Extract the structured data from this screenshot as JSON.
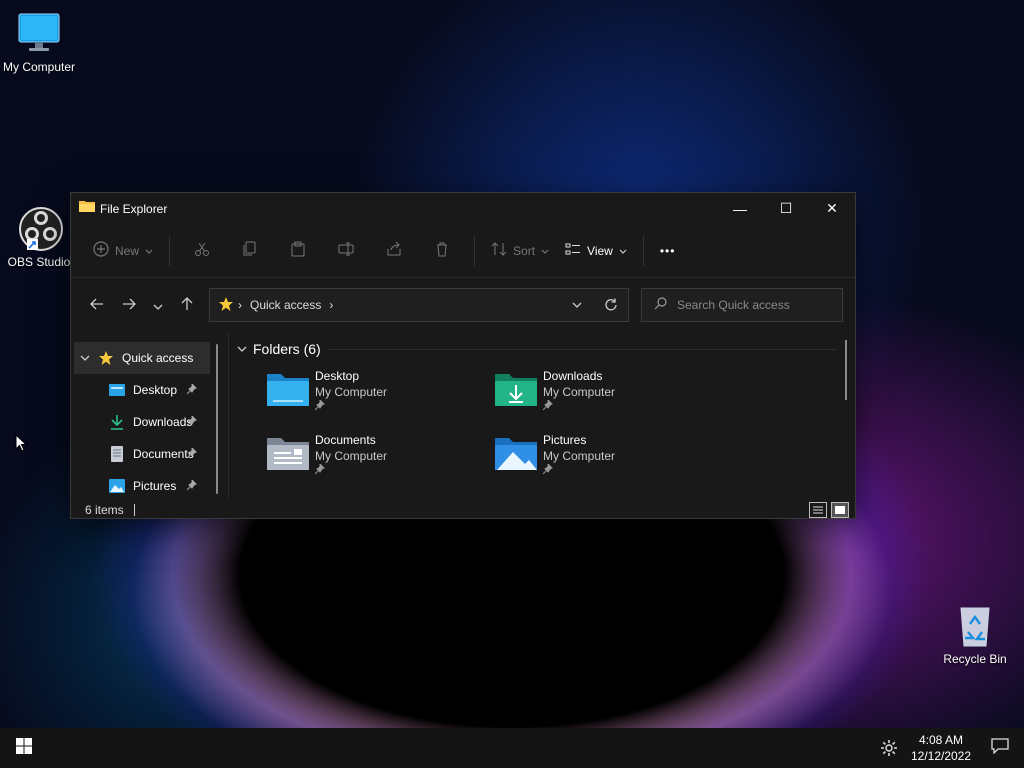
{
  "desktop": {
    "icons": [
      {
        "label": "My Computer",
        "icon": "monitor-icon"
      },
      {
        "label": "OBS Studio",
        "icon": "obs-icon"
      },
      {
        "label": "Recycle Bin",
        "icon": "recycle-bin-icon"
      }
    ]
  },
  "window": {
    "title": "File Explorer",
    "controls": {
      "minimize": "—",
      "maximize": "☐",
      "close": "✕"
    },
    "toolbar": {
      "new_label": "New",
      "sort_label": "Sort",
      "view_label": "View",
      "more_label": "•••"
    },
    "address": {
      "location": "Quick access",
      "separator": "›"
    },
    "search": {
      "placeholder": "Search Quick access"
    },
    "nav": {
      "root": "Quick access",
      "items": [
        {
          "label": "Desktop"
        },
        {
          "label": "Downloads"
        },
        {
          "label": "Documents"
        },
        {
          "label": "Pictures"
        }
      ]
    },
    "content": {
      "group_title": "Folders (6)",
      "folders": [
        {
          "name": "Desktop",
          "location": "My Computer"
        },
        {
          "name": "Downloads",
          "location": "My Computer"
        },
        {
          "name": "Documents",
          "location": "My Computer"
        },
        {
          "name": "Pictures",
          "location": "My Computer"
        }
      ]
    },
    "status": {
      "item_count": "6 items"
    }
  },
  "taskbar": {
    "time": "4:08 AM",
    "date": "12/12/2022"
  },
  "colors": {
    "accent": "#0078d4",
    "folder_blue": "#2aa3e8",
    "folder_green": "#1fa87a",
    "window_bg": "#191919"
  }
}
